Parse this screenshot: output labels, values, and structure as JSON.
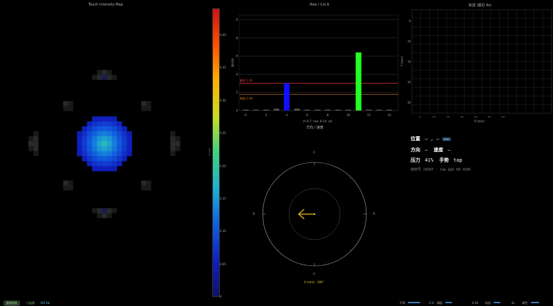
{
  "heatmap": {
    "title": "Touch Intensity Map",
    "colorbar_label": "A (mA)",
    "colorbar_ticks": [
      "0.40",
      "0.35",
      "0.30",
      "0.25",
      "0.20",
      "0.15",
      "0.10",
      "0.05",
      "0"
    ]
  },
  "bar_chart": {
    "title": "Row / Col Δ",
    "ylabel": "Δ(mA)",
    "threshold_high_label": "触发 0.30",
    "threshold_low_label": "释放 0.18",
    "xlabel": "ch 0-7: row, 8-14: col",
    "x_ticks": [
      "0",
      "2",
      "4",
      "6",
      "8",
      "10",
      "12",
      "14"
    ],
    "y_ticks": [
      "1.0",
      "0.8",
      "0.6",
      "0.4",
      "0.2",
      "0"
    ],
    "colors": {
      "blue": "#1010ff",
      "green": "#22ff22",
      "high_line": "#c03030",
      "low_line": "#b06a20"
    }
  },
  "chart_data": {
    "type": "bar",
    "categories": [
      "0",
      "1",
      "2",
      "3",
      "4",
      "5",
      "6",
      "7",
      "8",
      "9",
      "10",
      "11",
      "12",
      "13",
      "14"
    ],
    "values": [
      0.01,
      0.01,
      0.01,
      0.02,
      0.3,
      0.02,
      0.01,
      0.01,
      0.01,
      0.01,
      0.01,
      0.64,
      0.01,
      0.01,
      0.01
    ],
    "highlight": {
      "4": "blue",
      "11": "green"
    },
    "ylim": [
      0,
      1.05
    ],
    "thresholds": {
      "high": 0.3,
      "low": 0.18
    }
  },
  "trajectory": {
    "title": "轨迹 (最近 4s)",
    "xlabel": "X (mm)",
    "ylabel": "Y (mm)",
    "x_ticks": [
      "0",
      "10",
      "20",
      "30",
      "40",
      "50",
      "60"
    ],
    "y_ticks": [
      "0",
      "10",
      "20",
      "30",
      "40"
    ]
  },
  "compass": {
    "title": "方向 / 速度",
    "n": "Λ",
    "s": "V",
    "e": "R",
    "w": "R",
    "readout": "0 mm/s · 180°",
    "arrow_angle_deg": 180
  },
  "info": {
    "pos_label": "位置",
    "pos_value": "— , —",
    "pos_badge": "mm",
    "dir_label": "方向",
    "dir_value": "—",
    "speed_label": "速度",
    "speed_value": "—",
    "pressure_label": "压力",
    "pressure_value": "41%",
    "gesture_label": "手势",
    "gesture_value": "tap",
    "frame_line": "帧序号 24587 · raw Δpk 60.418%"
  },
  "footer": {
    "recalibrate": "重新校准",
    "connected": "已连接",
    "rate": "101 Hz",
    "smooth_label": "平滑",
    "smooth_value": "0.4",
    "threshold_label": "阈值",
    "threshold_value": "0.44",
    "trail_label": "轨迹",
    "trail_value": "4s",
    "theme_label": "调色"
  }
}
